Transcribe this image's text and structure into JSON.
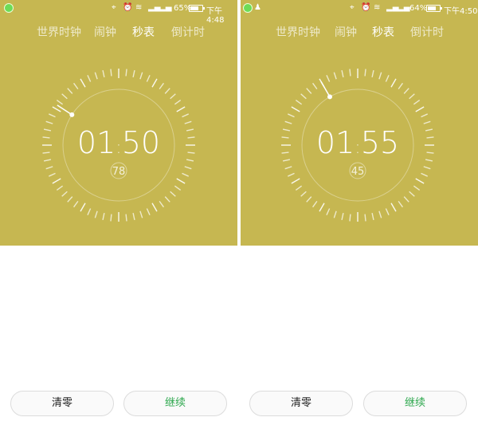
{
  "colors": {
    "accent_bg": "#c6b751",
    "resume_text": "#2fa84f"
  },
  "screens": [
    {
      "status": {
        "battery_pct": "65%",
        "battery_level": 0.65,
        "time": "下午4:48",
        "app_icons": [
          "app-shield-icon"
        ]
      },
      "tabs": [
        {
          "label": "世界时钟",
          "active": false
        },
        {
          "label": "闹钟",
          "active": false
        },
        {
          "label": "秒表",
          "active": true
        },
        {
          "label": "倒计时",
          "active": false
        }
      ],
      "stopwatch": {
        "minutes": "01",
        "seconds": "50",
        "sep": ":",
        "centis": "78",
        "hand_angle_deg": 303
      },
      "buttons": {
        "reset": "清零",
        "resume": "继续"
      }
    },
    {
      "status": {
        "battery_pct": "64%",
        "battery_level": 0.64,
        "time": "下午4:50",
        "app_icons": [
          "app-shield-icon",
          "qq-icon"
        ]
      },
      "tabs": [
        {
          "label": "世界时钟",
          "active": false
        },
        {
          "label": "闹钟",
          "active": false
        },
        {
          "label": "秒表",
          "active": true
        },
        {
          "label": "倒计时",
          "active": false
        }
      ],
      "stopwatch": {
        "minutes": "01",
        "seconds": "55",
        "sep": ":",
        "centis": "45",
        "hand_angle_deg": 330
      },
      "buttons": {
        "reset": "清零",
        "resume": "继续"
      }
    }
  ]
}
